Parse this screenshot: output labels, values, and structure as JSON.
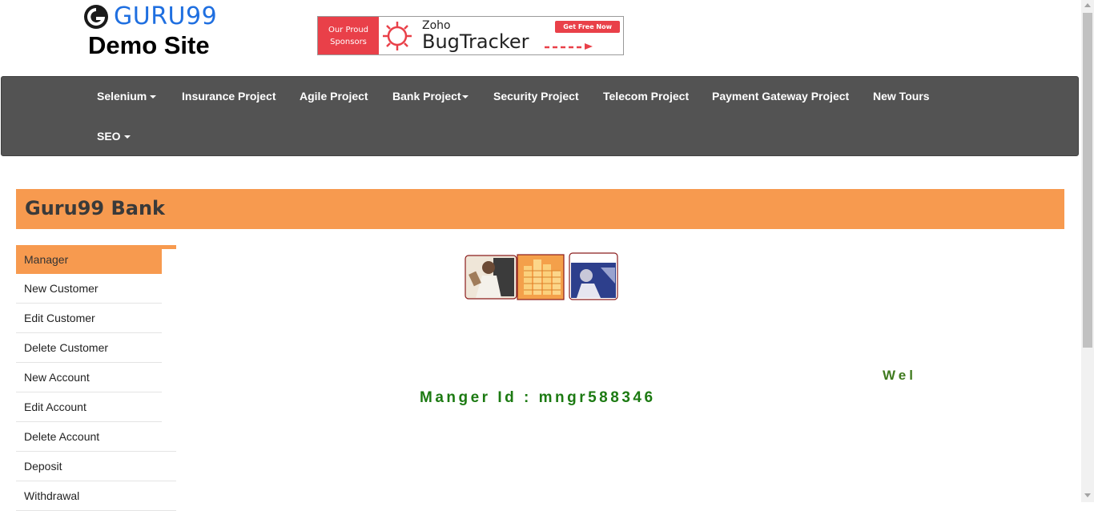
{
  "header": {
    "logo_text": "GURU99",
    "logo_sub": "Demo Site",
    "banner": {
      "left_line1": "Our Proud",
      "left_line2": "Sponsors",
      "brand_small": "Zoho",
      "brand_big": "BugTracker",
      "cta": "Get Free Now"
    }
  },
  "nav": {
    "row1": [
      {
        "label": "Selenium",
        "dropdown": true
      },
      {
        "label": "Insurance Project",
        "dropdown": false
      },
      {
        "label": "Agile Project",
        "dropdown": false
      },
      {
        "label": "Bank Project",
        "dropdown": true
      },
      {
        "label": "Security Project",
        "dropdown": false
      },
      {
        "label": "Telecom Project",
        "dropdown": false
      },
      {
        "label": "Payment Gateway Project",
        "dropdown": false
      },
      {
        "label": "New Tours",
        "dropdown": false
      }
    ],
    "row2": [
      {
        "label": "SEO",
        "dropdown": true
      }
    ]
  },
  "bank": {
    "title": "Guru99 Bank"
  },
  "menu": {
    "items": [
      {
        "label": "Manager",
        "active": true
      },
      {
        "label": "New Customer"
      },
      {
        "label": "Edit Customer"
      },
      {
        "label": "Delete Customer"
      },
      {
        "label": "New Account"
      },
      {
        "label": "Edit Account"
      },
      {
        "label": "Delete Account"
      },
      {
        "label": "Deposit"
      },
      {
        "label": "Withdrawal"
      }
    ]
  },
  "main": {
    "welcome_text": "Wel",
    "manager_id_text": "Manger Id : mngr588346"
  },
  "colors": {
    "accent_orange": "#f79a4f",
    "nav_bg": "#535353",
    "logo_blue": "#1f6fe0",
    "green_text": "#1c7a12"
  }
}
